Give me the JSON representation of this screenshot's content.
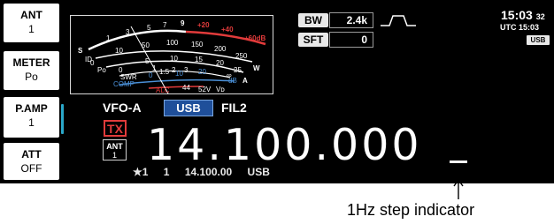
{
  "softkeys": [
    {
      "title": "ANT",
      "value": "1"
    },
    {
      "title": "METER",
      "value": "Po"
    },
    {
      "title": "P.AMP",
      "value": "1"
    },
    {
      "title": "ATT",
      "value": "OFF"
    }
  ],
  "meter": {
    "s_scale": [
      "1",
      "3",
      "5",
      "7",
      "9",
      "+20",
      "+40",
      "+60dB"
    ],
    "s_label": "S",
    "po_scale": [
      "0",
      "10",
      "50",
      "100",
      "150",
      "200",
      "250"
    ],
    "po_label": "Po",
    "w_label": "W",
    "id_scale": [
      "0",
      "5",
      "10",
      "15",
      "20",
      "25"
    ],
    "a_label": "A",
    "id_label": "ID",
    "swr_scale": [
      "1",
      "1.5",
      "2",
      "3",
      "∞"
    ],
    "swr_label": "SWR",
    "comp_label": "COMP",
    "comp_scale": [
      "0",
      "10",
      "20"
    ],
    "comp_unit": "dB",
    "alc_label": "ALC",
    "vd_scale": [
      "44",
      "52V"
    ],
    "vd_label": "Vᴅ"
  },
  "bw": {
    "label": "BW",
    "value": "2.4k"
  },
  "sft": {
    "label": "SFT",
    "value": "0"
  },
  "clock": {
    "time": "15:03",
    "seconds": "32",
    "utc": "UTC 15:03",
    "mode": "USB"
  },
  "vfo": {
    "name": "VFO-A",
    "mode": "USB",
    "filter": "FIL2"
  },
  "tx_label": "TX",
  "ant_indicator": {
    "label": "ANT",
    "value": "1"
  },
  "frequency": "14.100.000",
  "memory_line": {
    "star": "★1",
    "ch": "1",
    "freq": "14.100.00",
    "mode": "USB"
  },
  "caption": "1Hz step indicator"
}
